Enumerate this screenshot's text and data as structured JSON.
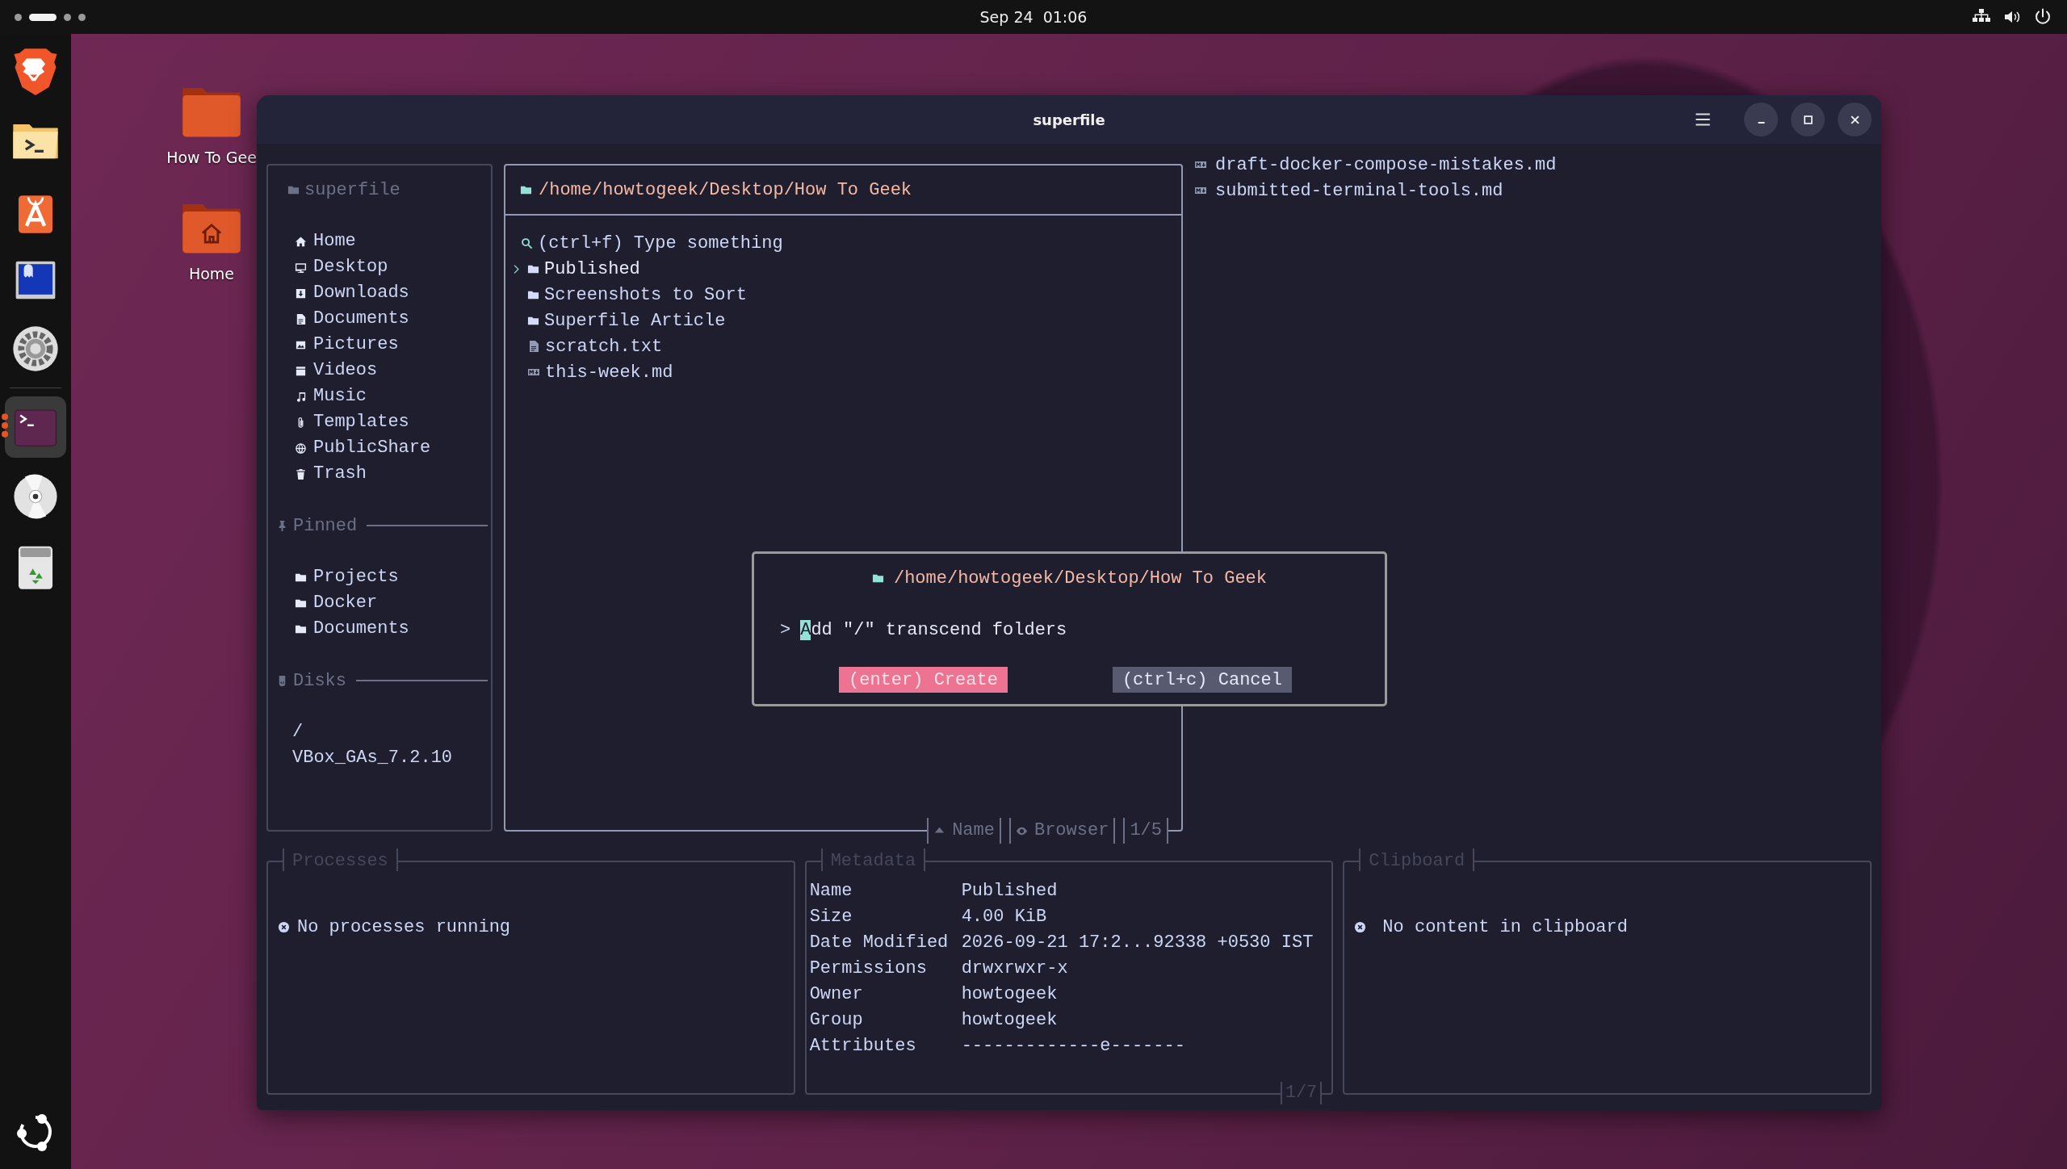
{
  "top_bar": {
    "workspaces": [
      {
        "selected": false
      },
      {
        "selected": true
      },
      {
        "selected": false
      },
      {
        "selected": false
      }
    ],
    "clock": "Sep 24  01:06",
    "tray": [
      {
        "kind": "network"
      },
      {
        "kind": "volume"
      },
      {
        "kind": "power"
      }
    ]
  },
  "dock": {
    "apps": [
      {
        "kind": "shield",
        "running": false
      },
      {
        "kind": "folder-terminal",
        "running": false
      },
      {
        "kind": "store",
        "running": false
      },
      {
        "kind": "monitor",
        "running": false
      },
      {
        "kind": "settings",
        "running": false
      },
      {
        "kind": "terminal",
        "running": true
      },
      {
        "kind": "disc",
        "running": false
      },
      {
        "kind": "trash",
        "running": false
      }
    ],
    "launcher": {
      "kind": "ring"
    }
  },
  "desktop_icons": [
    {
      "label": "How To Gee",
      "kind": "folder"
    },
    {
      "label": "Home",
      "kind": "home"
    }
  ],
  "window": {
    "title": "superfile",
    "sidebar": {
      "title": "superfile",
      "items": [
        {
          "label": "Home",
          "kind": "home"
        },
        {
          "label": "Desktop",
          "kind": "monitor"
        },
        {
          "label": "Downloads",
          "kind": "download"
        },
        {
          "label": "Documents",
          "kind": "document"
        },
        {
          "label": "Pictures",
          "kind": "picture"
        },
        {
          "label": "Videos",
          "kind": "video"
        },
        {
          "label": "Music",
          "kind": "music"
        },
        {
          "label": "Templates",
          "kind": "clip"
        },
        {
          "label": "PublicShare",
          "kind": "globe"
        },
        {
          "label": "Trash",
          "kind": "trash"
        }
      ],
      "pinned": {
        "title": "Pinned",
        "items": [
          {
            "label": "Projects",
            "kind": "folder"
          },
          {
            "label": "Docker",
            "kind": "folder"
          },
          {
            "label": "Documents",
            "kind": "folder"
          }
        ]
      },
      "disks": {
        "title": "Disks",
        "items": [
          {
            "label": "/"
          },
          {
            "label": "VBox_GAs_7.2.10"
          }
        ]
      }
    },
    "file_panel": {
      "path": "/home/howtogeek/Desktop/How To Geek",
      "search": {
        "placeholder": "(ctrl+f) Type something"
      },
      "files": [
        {
          "name": "Published",
          "kind": "folder",
          "selected": true
        },
        {
          "name": "Screenshots to Sort",
          "kind": "folder",
          "selected": false
        },
        {
          "name": "Superfile Article",
          "kind": "folder",
          "selected": false
        },
        {
          "name": "scratch.txt",
          "kind": "text",
          "selected": false
        },
        {
          "name": "this-week.md",
          "kind": "markdown",
          "selected": false
        }
      ],
      "footer": {
        "sort": "Name",
        "mode": "Browser",
        "position": "1/5"
      }
    },
    "preview": {
      "files": [
        {
          "name": "draft-docker-compose-mistakes.md",
          "kind": "markdown"
        },
        {
          "name": "submitted-terminal-tools.md",
          "kind": "markdown"
        }
      ]
    },
    "processes": {
      "title": "Processes",
      "message": "No processes running"
    },
    "metadata": {
      "title": "Metadata",
      "rows": [
        {
          "label": "Name",
          "value": "Published"
        },
        {
          "label": "Size",
          "value": "4.00 KiB"
        },
        {
          "label": "Date Modified",
          "value": "2026-09-21 17:2...92338 +0530 IST"
        },
        {
          "label": "Permissions",
          "value": "drwxrwxr-x"
        },
        {
          "label": "Owner",
          "value": "howtogeek"
        },
        {
          "label": "Group",
          "value": "howtogeek"
        },
        {
          "label": "Attributes",
          "value": "-------------e-------"
        }
      ],
      "position": "1/7"
    },
    "clipboard": {
      "title": "Clipboard",
      "message": "No content in clipboard"
    },
    "dialog": {
      "path": "/home/howtogeek/Desktop/How To Geek",
      "prompt": ">",
      "value": "Add \"/\" transcend folders",
      "buttons": [
        {
          "label": "(enter) Create",
          "kind": "primary"
        },
        {
          "label": "(ctrl+c) Cancel",
          "kind": "secondary"
        }
      ]
    }
  }
}
